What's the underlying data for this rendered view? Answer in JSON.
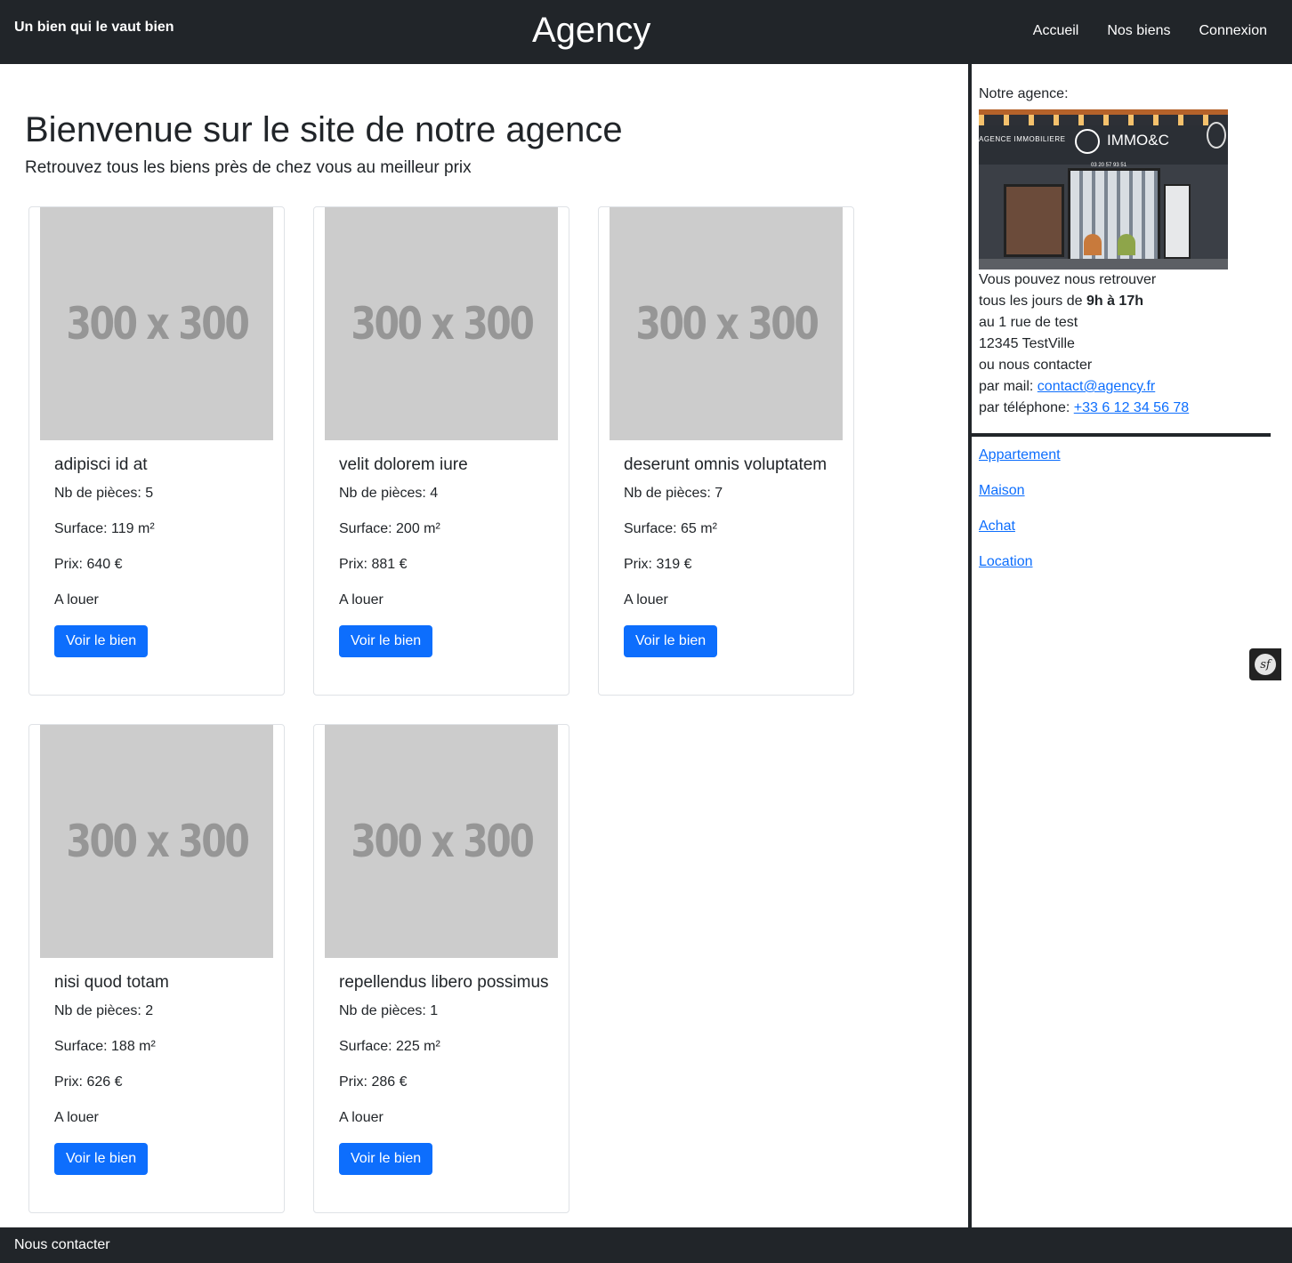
{
  "header": {
    "tagline": "Un bien qui le vaut bien",
    "brand": "Agency",
    "nav": [
      "Accueil",
      "Nos biens",
      "Connexion"
    ]
  },
  "main": {
    "title": "Bienvenue sur le site de notre agence",
    "subtitle": "Retrouvez tous les biens près de chez vous au meilleur prix",
    "placeholder_text": "300 x 300",
    "cards": [
      {
        "title": "adipisci id at",
        "rooms": "Nb de pièces: 5",
        "surface": "Surface: 119 m²",
        "price": "Prix: 640 €",
        "status": "A louer",
        "button": "Voir le bien"
      },
      {
        "title": "velit dolorem iure",
        "rooms": "Nb de pièces: 4",
        "surface": "Surface: 200 m²",
        "price": "Prix: 881 €",
        "status": "A louer",
        "button": "Voir le bien"
      },
      {
        "title": "deserunt omnis voluptatem",
        "rooms": "Nb de pièces: 7",
        "surface": "Surface: 65 m²",
        "price": "Prix: 319 €",
        "status": "A louer",
        "button": "Voir le bien"
      },
      {
        "title": "nisi quod totam",
        "rooms": "Nb de pièces: 2",
        "surface": "Surface: 188 m²",
        "price": "Prix: 626 €",
        "status": "A louer",
        "button": "Voir le bien"
      },
      {
        "title": "repellendus libero possimus",
        "rooms": "Nb de pièces: 1",
        "surface": "Surface: 225 m²",
        "price": "Prix: 286 €",
        "status": "A louer",
        "button": "Voir le bien"
      }
    ]
  },
  "sidebar": {
    "title": "Notre agence:",
    "photo": {
      "sign_left": "AGENCE IMMOBILIERE",
      "sign_right": "IMMO&C",
      "phone": "03 20 57 93 51"
    },
    "contact": {
      "line1": "Vous pouvez nous retrouver",
      "line2_prefix": "tous les jours de ",
      "hours": "9h à 17h",
      "line3": "au 1 rue de test",
      "line4": "12345 TestVille",
      "line5": "ou nous contacter",
      "mail_prefix": "par mail: ",
      "mail": "contact@agency.fr",
      "phone_prefix": "par téléphone: ",
      "phone": "+33 6 12 34 56 78"
    },
    "categories": [
      "Appartement",
      "Maison",
      "Achat",
      "Location"
    ]
  },
  "debug_badge": {
    "label": "sf",
    "icon": "symfony-icon"
  },
  "footer": {
    "label": "Nous contacter"
  },
  "colors": {
    "dark": "#212529",
    "primary": "#0d6efd",
    "placeholder": "#cccccc"
  }
}
